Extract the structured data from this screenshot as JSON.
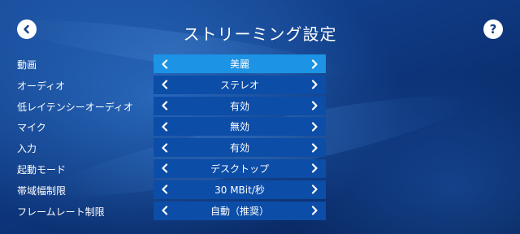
{
  "header": {
    "title": "ストリーミング設定",
    "back_icon": "chevron-left-icon",
    "help_label": "?"
  },
  "colors": {
    "selector": "#0c4da8",
    "selector_selected": "#1c93e4",
    "background": "#103c86"
  },
  "settings": [
    {
      "label": "動画",
      "value": "美麗",
      "selected": true
    },
    {
      "label": "オーディオ",
      "value": "ステレオ"
    },
    {
      "label": "低レイテンシーオーディオ",
      "value": "有効"
    },
    {
      "label": "マイク",
      "value": "無効"
    },
    {
      "label": "入力",
      "value": "有効"
    },
    {
      "label": "起動モード",
      "value": "デスクトップ"
    },
    {
      "label": "帯域幅制限",
      "value": "30 MBit/秒"
    },
    {
      "label": "フレームレート制限",
      "value": "自動（推奨）"
    }
  ]
}
